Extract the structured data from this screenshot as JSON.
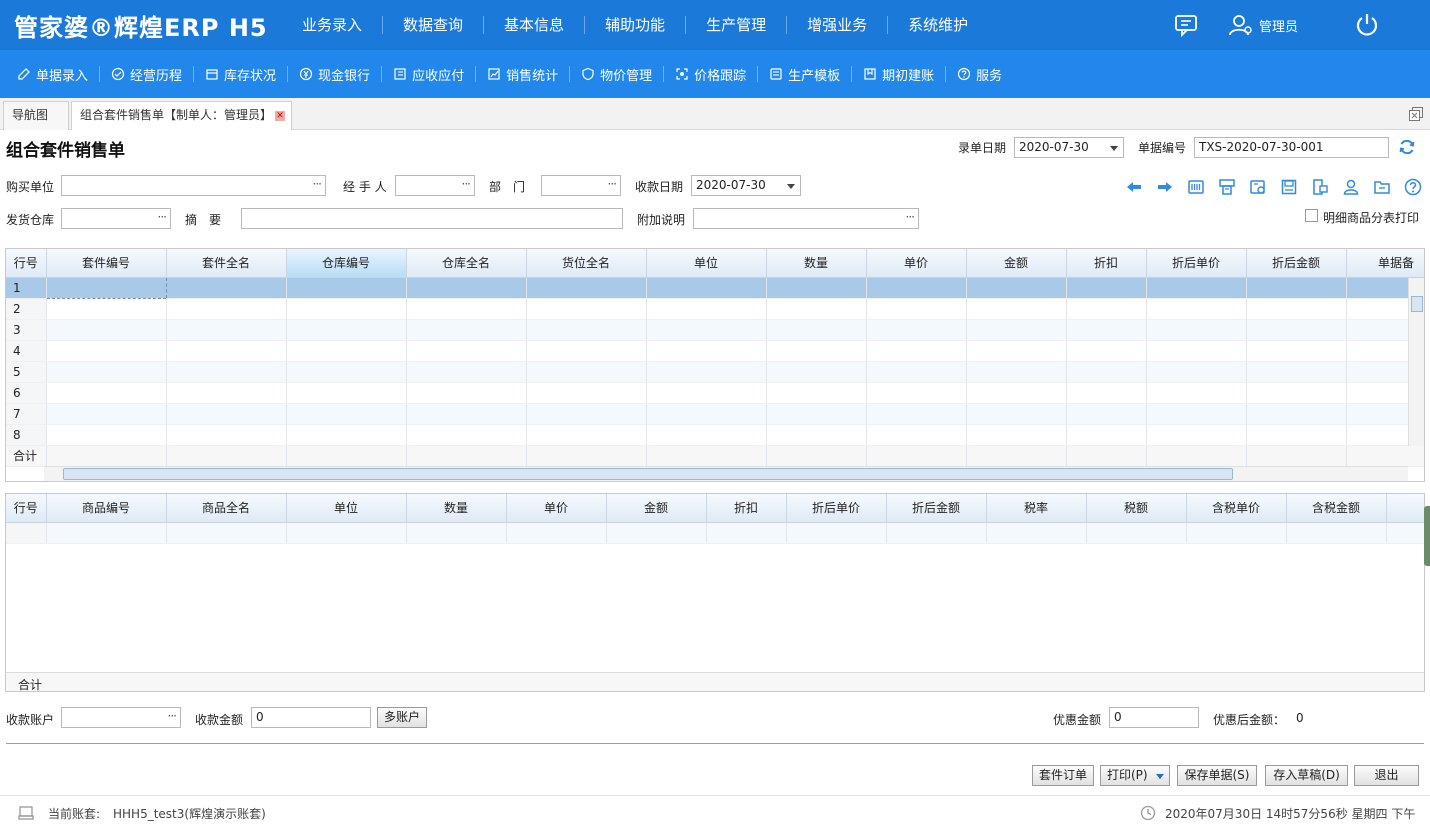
{
  "app": {
    "logo": "管家婆®辉煌ERP H5",
    "user": "管理员"
  },
  "top_nav": [
    "业务录入",
    "数据查询",
    "基本信息",
    "辅助功能",
    "生产管理",
    "增强业务",
    "系统维护"
  ],
  "sub_nav": [
    {
      "label": "单据录入",
      "icon": "edit-icon"
    },
    {
      "label": "经营历程",
      "icon": "check-circle-icon"
    },
    {
      "label": "库存状况",
      "icon": "inventory-icon"
    },
    {
      "label": "现金银行",
      "icon": "yen-icon"
    },
    {
      "label": "应收应付",
      "icon": "ledger-icon"
    },
    {
      "label": "销售统计",
      "icon": "chart-icon"
    },
    {
      "label": "物价管理",
      "icon": "shield-icon"
    },
    {
      "label": "价格跟踪",
      "icon": "track-icon"
    },
    {
      "label": "生产模板",
      "icon": "template-icon"
    },
    {
      "label": "期初建账",
      "icon": "book-icon"
    },
    {
      "label": "服务",
      "icon": "help-icon"
    }
  ],
  "tabs": {
    "nav": "导航图",
    "doc": "组合套件销售单【制单人：管理员】"
  },
  "form": {
    "title": "组合套件销售单",
    "date_label": "录单日期",
    "date_value": "2020-07-30",
    "docno_label": "单据编号",
    "docno_value": "TXS-2020-07-30-001",
    "buyer_label": "购买单位",
    "buyer_value": "",
    "handler_label": "经 手 人",
    "handler_value": "",
    "dept_label": "部　门",
    "dept_value": "",
    "receipt_date_label": "收款日期",
    "receipt_date_value": "2020-07-30",
    "warehouse_label": "发货仓库",
    "warehouse_value": "",
    "summary_label": "摘　要",
    "summary_value": "",
    "extra_label": "附加说明",
    "extra_value": "",
    "detail_print_label": "明细商品分表打印"
  },
  "toolbar_icons": [
    "arrow-left-icon",
    "arrow-right-icon",
    "barcode-icon",
    "print-icon",
    "config-icon",
    "save-icon",
    "export-icon",
    "user-icon",
    "folder-icon",
    "help-icon"
  ],
  "grid1": {
    "columns": [
      "行号",
      "套件编号",
      "套件全名",
      "仓库编号",
      "仓库全名",
      "货位全名",
      "单位",
      "数量",
      "单价",
      "金额",
      "折扣",
      "折后单价",
      "折后金额",
      "单据备"
    ],
    "rows": [
      "1",
      "2",
      "3",
      "4",
      "5",
      "6",
      "7",
      "8"
    ],
    "total_label": "合计"
  },
  "grid2": {
    "columns": [
      "行号",
      "商品编号",
      "商品全名",
      "单位",
      "数量",
      "单价",
      "金额",
      "折扣",
      "折后单价",
      "折后金额",
      "税率",
      "税额",
      "含税单价",
      "含税金额"
    ],
    "total_label": "合计"
  },
  "payment": {
    "account_label": "收款账户",
    "account_value": "",
    "amount_label": "收款金额",
    "amount_value": "0",
    "multi_label": "多账户",
    "discount_label": "优惠金额",
    "discount_value": "0",
    "after_label": "优惠后金额：",
    "after_value": "0"
  },
  "buttons": {
    "kit_order": "套件订单",
    "print": "打印(P)",
    "save": "保存单据(S)",
    "draft": "存入草稿(D)",
    "exit": "退出"
  },
  "footer": {
    "account_label": "当前账套:",
    "account_value": "HHH5_test3(辉煌演示账套)",
    "datetime": "2020年07月30日 14时57分56秒 星期四 下午"
  }
}
